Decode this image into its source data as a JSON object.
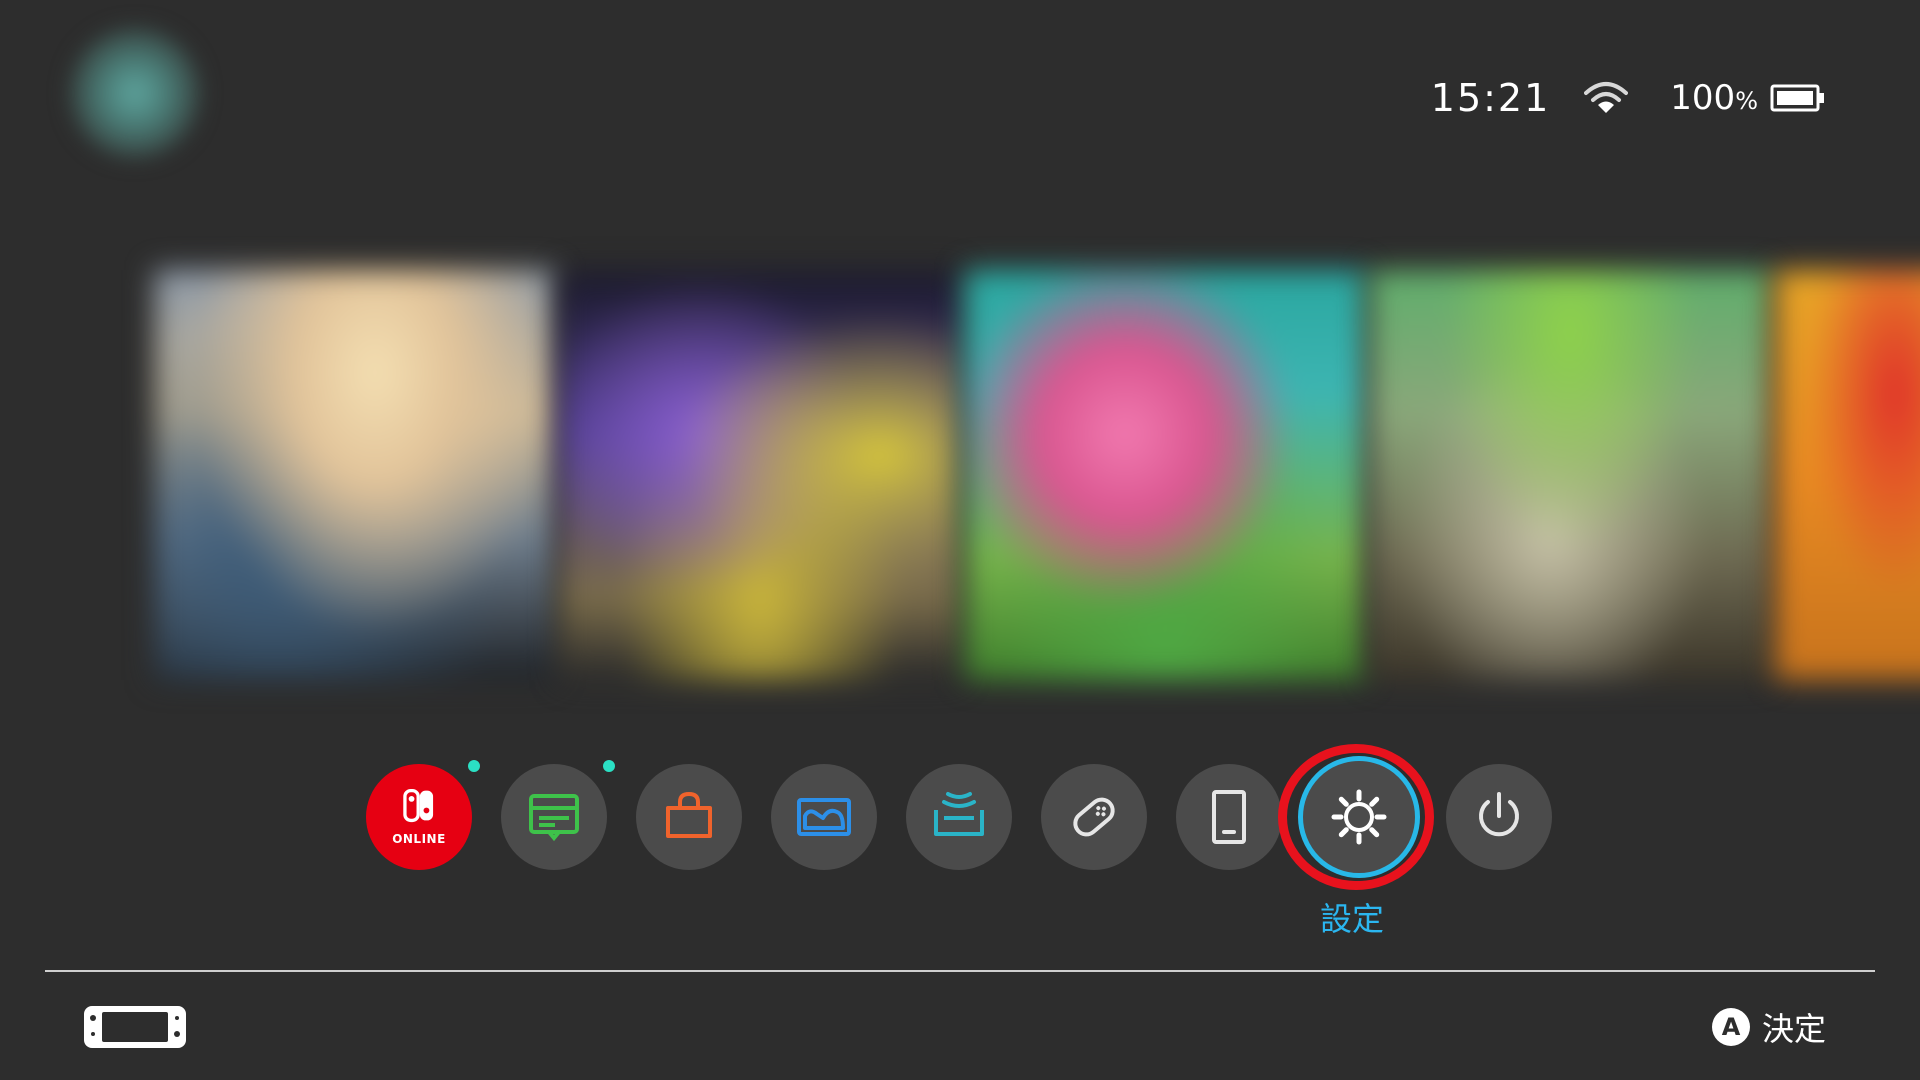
{
  "status": {
    "time": "15:21",
    "battery_percent": "100",
    "battery_unit": "%",
    "wifi_icon": "wifi-icon",
    "battery_icon": "battery-full-icon"
  },
  "user": {
    "avatar_icon": "user-avatar-icon"
  },
  "games": [
    {
      "name": "game-tile-1"
    },
    {
      "name": "game-tile-2"
    },
    {
      "name": "game-tile-3"
    },
    {
      "name": "game-tile-4"
    },
    {
      "name": "game-tile-5"
    }
  ],
  "quick_menu": {
    "online_label": "ONLINE",
    "selected_label": "設定",
    "items": [
      {
        "icon": "nintendo-switch-online-icon",
        "has_notification": true
      },
      {
        "icon": "news-icon",
        "has_notification": true
      },
      {
        "icon": "eshop-icon",
        "has_notification": false
      },
      {
        "icon": "album-icon",
        "has_notification": false
      },
      {
        "icon": "controllers-icon",
        "has_notification": false
      },
      {
        "icon": "controller-settings-icon",
        "has_notification": false
      },
      {
        "icon": "sleep-mode-icon",
        "has_notification": false
      },
      {
        "icon": "system-settings-icon",
        "has_notification": false
      },
      {
        "icon": "power-icon",
        "has_notification": false
      }
    ],
    "selected_color": "#28b8e8",
    "highlight_color": "#e8121d"
  },
  "footer": {
    "console_icon": "handheld-console-icon",
    "a_button": "A",
    "hint_label": "決定"
  }
}
